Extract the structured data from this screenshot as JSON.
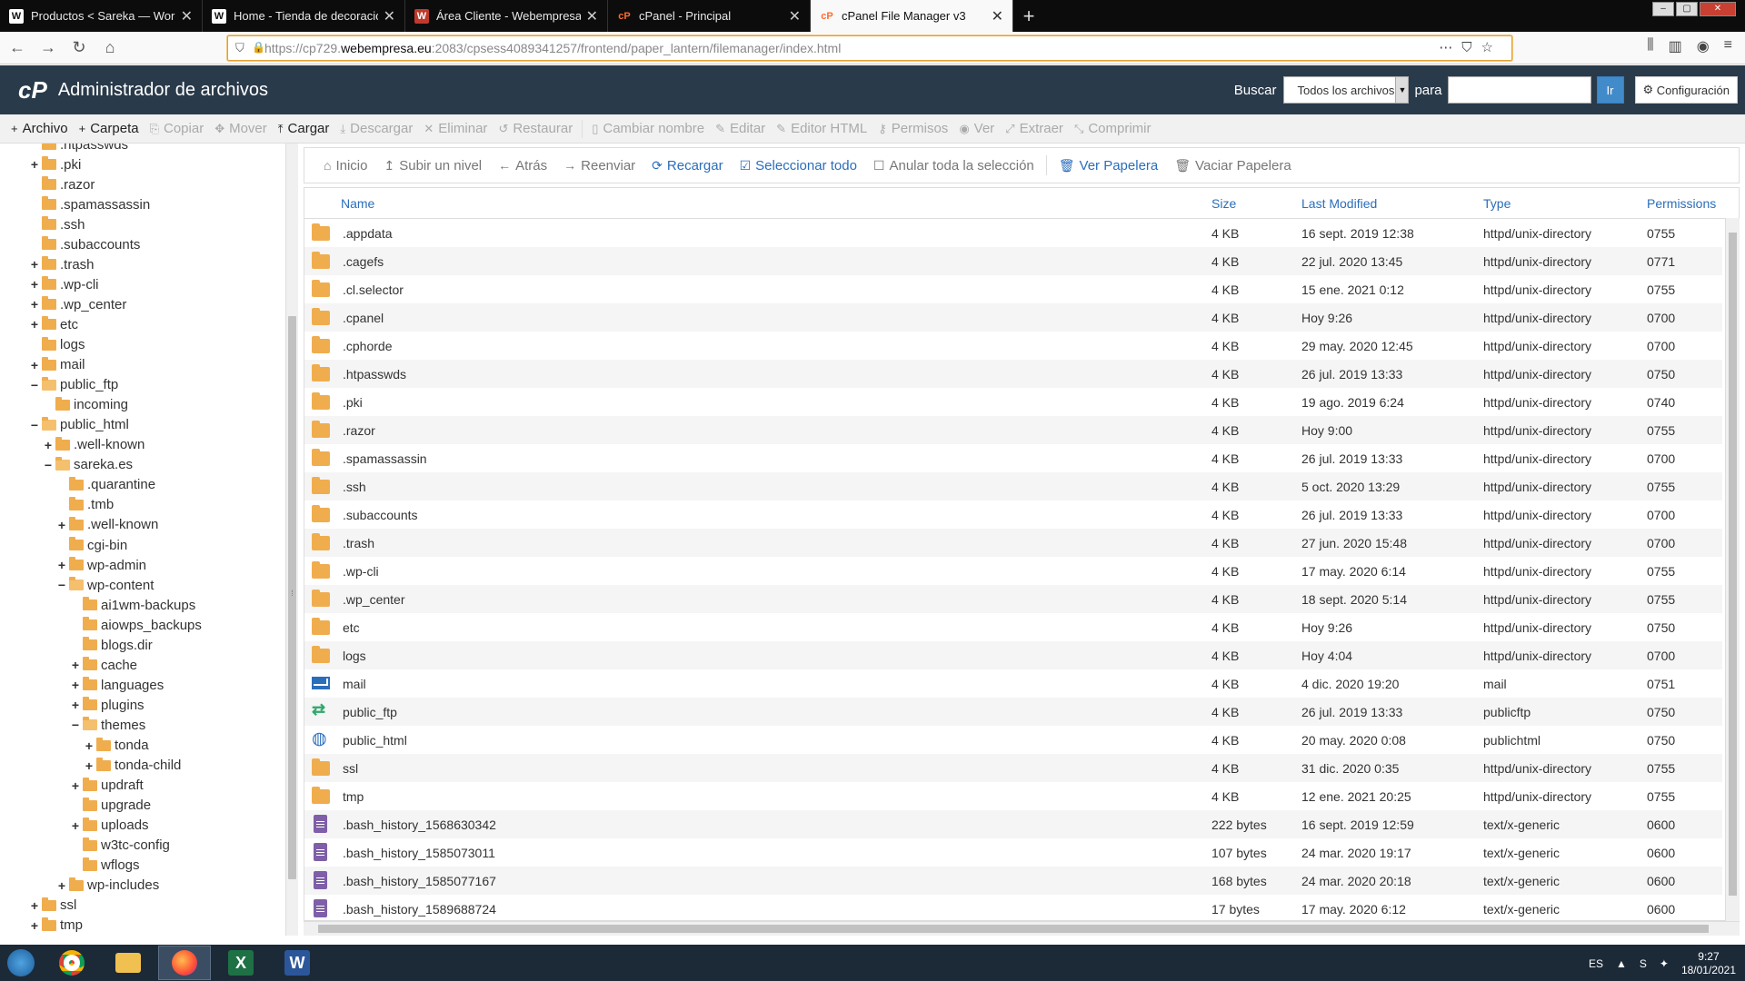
{
  "browser": {
    "tabs": [
      {
        "label": "Productos < Sareka — WordPre",
        "icon": "wordpress-icon"
      },
      {
        "label": "Home - Tienda de decoración",
        "icon": "wordpress-icon"
      },
      {
        "label": "Área Cliente - Webempresa Eur",
        "icon": "webempresa-icon"
      },
      {
        "label": "cPanel - Principal",
        "icon": "cpanel-icon"
      },
      {
        "label": "cPanel File Manager v3",
        "icon": "cpanel-icon"
      }
    ],
    "url_prefix": "https://cp729.",
    "url_domain": "webempresa.eu",
    "url_rest": ":2083/cpsess4089341257/frontend/paper_lantern/filemanager/index.html"
  },
  "header": {
    "logo": "cP",
    "title": "Administrador de archivos",
    "search_label": "Buscar",
    "search_scope": "Todos los archivos",
    "for_label": "para",
    "go_label": "Ir",
    "settings_label": "Configuración"
  },
  "toolbar": [
    {
      "label": "Archivo",
      "icon": "+",
      "enabled": true
    },
    {
      "label": "Carpeta",
      "icon": "+",
      "enabled": true
    },
    {
      "label": "Copiar",
      "icon": "⎘",
      "enabled": false
    },
    {
      "label": "Mover",
      "icon": "✥",
      "enabled": false
    },
    {
      "label": "Cargar",
      "icon": "⤒",
      "enabled": true
    },
    {
      "label": "Descargar",
      "icon": "⤓",
      "enabled": false
    },
    {
      "label": "Eliminar",
      "icon": "✕",
      "enabled": false
    },
    {
      "label": "Restaurar",
      "icon": "↺",
      "enabled": false
    },
    {
      "label": "Cambiar nombre",
      "icon": "▯",
      "enabled": false
    },
    {
      "label": "Editar",
      "icon": "✎",
      "enabled": false
    },
    {
      "label": "Editor HTML",
      "icon": "✎",
      "enabled": false
    },
    {
      "label": "Permisos",
      "icon": "⚷",
      "enabled": false
    },
    {
      "label": "Ver",
      "icon": "◉",
      "enabled": false
    },
    {
      "label": "Extraer",
      "icon": "⤢",
      "enabled": false
    },
    {
      "label": "Comprimir",
      "icon": "⤡",
      "enabled": false
    }
  ],
  "actions": [
    {
      "label": "Inicio",
      "icon": "⌂",
      "style": "grey"
    },
    {
      "label": "Subir un nivel",
      "icon": "↥",
      "style": "grey"
    },
    {
      "label": "Atrás",
      "icon": "←",
      "style": "grey"
    },
    {
      "label": "Reenviar",
      "icon": "→",
      "style": "grey"
    },
    {
      "label": "Recargar",
      "icon": "⟳",
      "style": "blue"
    },
    {
      "label": "Seleccionar todo",
      "icon": "☑",
      "style": "blue"
    },
    {
      "label": "Anular toda la selección",
      "icon": "☐",
      "style": "grey"
    },
    {
      "label": "Ver Papelera",
      "icon": "🗑",
      "style": "blue"
    },
    {
      "label": "Vaciar Papelera",
      "icon": "🗑",
      "style": "grey"
    }
  ],
  "tree": [
    {
      "label": ".htpasswds",
      "depth": 0,
      "toggle": "",
      "open": false
    },
    {
      "label": ".pki",
      "depth": 0,
      "toggle": "+",
      "open": false
    },
    {
      "label": ".razor",
      "depth": 0,
      "toggle": "",
      "open": false
    },
    {
      "label": ".spamassassin",
      "depth": 0,
      "toggle": "",
      "open": false
    },
    {
      "label": ".ssh",
      "depth": 0,
      "toggle": "",
      "open": false
    },
    {
      "label": ".subaccounts",
      "depth": 0,
      "toggle": "",
      "open": false
    },
    {
      "label": ".trash",
      "depth": 0,
      "toggle": "+",
      "open": false
    },
    {
      "label": ".wp-cli",
      "depth": 0,
      "toggle": "+",
      "open": false
    },
    {
      "label": ".wp_center",
      "depth": 0,
      "toggle": "+",
      "open": false
    },
    {
      "label": "etc",
      "depth": 0,
      "toggle": "+",
      "open": false
    },
    {
      "label": "logs",
      "depth": 0,
      "toggle": "",
      "open": false
    },
    {
      "label": "mail",
      "depth": 0,
      "toggle": "+",
      "open": false
    },
    {
      "label": "public_ftp",
      "depth": 0,
      "toggle": "−",
      "open": true
    },
    {
      "label": "incoming",
      "depth": 1,
      "toggle": "",
      "open": false
    },
    {
      "label": "public_html",
      "depth": 0,
      "toggle": "−",
      "open": true
    },
    {
      "label": ".well-known",
      "depth": 1,
      "toggle": "+",
      "open": false
    },
    {
      "label": "sareka.es",
      "depth": 1,
      "toggle": "−",
      "open": true
    },
    {
      "label": ".quarantine",
      "depth": 2,
      "toggle": "",
      "open": false
    },
    {
      "label": ".tmb",
      "depth": 2,
      "toggle": "",
      "open": false
    },
    {
      "label": ".well-known",
      "depth": 2,
      "toggle": "+",
      "open": false
    },
    {
      "label": "cgi-bin",
      "depth": 2,
      "toggle": "",
      "open": false
    },
    {
      "label": "wp-admin",
      "depth": 2,
      "toggle": "+",
      "open": false
    },
    {
      "label": "wp-content",
      "depth": 2,
      "toggle": "−",
      "open": true
    },
    {
      "label": "ai1wm-backups",
      "depth": 3,
      "toggle": "",
      "open": false
    },
    {
      "label": "aiowps_backups",
      "depth": 3,
      "toggle": "",
      "open": false
    },
    {
      "label": "blogs.dir",
      "depth": 3,
      "toggle": "",
      "open": false
    },
    {
      "label": "cache",
      "depth": 3,
      "toggle": "+",
      "open": false
    },
    {
      "label": "languages",
      "depth": 3,
      "toggle": "+",
      "open": false
    },
    {
      "label": "plugins",
      "depth": 3,
      "toggle": "+",
      "open": false
    },
    {
      "label": "themes",
      "depth": 3,
      "toggle": "−",
      "open": true
    },
    {
      "label": "tonda",
      "depth": 4,
      "toggle": "+",
      "open": false
    },
    {
      "label": "tonda-child",
      "depth": 4,
      "toggle": "+",
      "open": false
    },
    {
      "label": "updraft",
      "depth": 3,
      "toggle": "+",
      "open": false
    },
    {
      "label": "upgrade",
      "depth": 3,
      "toggle": "",
      "open": false
    },
    {
      "label": "uploads",
      "depth": 3,
      "toggle": "+",
      "open": false
    },
    {
      "label": "w3tc-config",
      "depth": 3,
      "toggle": "",
      "open": false
    },
    {
      "label": "wflogs",
      "depth": 3,
      "toggle": "",
      "open": false
    },
    {
      "label": "wp-includes",
      "depth": 2,
      "toggle": "+",
      "open": false
    },
    {
      "label": "ssl",
      "depth": 0,
      "toggle": "+",
      "open": false
    },
    {
      "label": "tmp",
      "depth": 0,
      "toggle": "+",
      "open": false
    }
  ],
  "columns": {
    "name": "Name",
    "size": "Size",
    "modified": "Last Modified",
    "type": "Type",
    "perms": "Permissions"
  },
  "files": [
    {
      "icon": "folder",
      "name": ".appdata",
      "size": "4 KB",
      "modified": "16 sept. 2019 12:38",
      "type": "httpd/unix-directory",
      "perms": "0755"
    },
    {
      "icon": "folder",
      "name": ".cagefs",
      "size": "4 KB",
      "modified": "22 jul. 2020 13:45",
      "type": "httpd/unix-directory",
      "perms": "0771"
    },
    {
      "icon": "folder",
      "name": ".cl.selector",
      "size": "4 KB",
      "modified": "15 ene. 2021 0:12",
      "type": "httpd/unix-directory",
      "perms": "0755"
    },
    {
      "icon": "folder",
      "name": ".cpanel",
      "size": "4 KB",
      "modified": "Hoy 9:26",
      "type": "httpd/unix-directory",
      "perms": "0700"
    },
    {
      "icon": "folder",
      "name": ".cphorde",
      "size": "4 KB",
      "modified": "29 may. 2020 12:45",
      "type": "httpd/unix-directory",
      "perms": "0700"
    },
    {
      "icon": "folder",
      "name": ".htpasswds",
      "size": "4 KB",
      "modified": "26 jul. 2019 13:33",
      "type": "httpd/unix-directory",
      "perms": "0750"
    },
    {
      "icon": "folder",
      "name": ".pki",
      "size": "4 KB",
      "modified": "19 ago. 2019 6:24",
      "type": "httpd/unix-directory",
      "perms": "0740"
    },
    {
      "icon": "folder",
      "name": ".razor",
      "size": "4 KB",
      "modified": "Hoy 9:00",
      "type": "httpd/unix-directory",
      "perms": "0755"
    },
    {
      "icon": "folder",
      "name": ".spamassassin",
      "size": "4 KB",
      "modified": "26 jul. 2019 13:33",
      "type": "httpd/unix-directory",
      "perms": "0700"
    },
    {
      "icon": "folder",
      "name": ".ssh",
      "size": "4 KB",
      "modified": "5 oct. 2020 13:29",
      "type": "httpd/unix-directory",
      "perms": "0755"
    },
    {
      "icon": "folder",
      "name": ".subaccounts",
      "size": "4 KB",
      "modified": "26 jul. 2019 13:33",
      "type": "httpd/unix-directory",
      "perms": "0700"
    },
    {
      "icon": "folder",
      "name": ".trash",
      "size": "4 KB",
      "modified": "27 jun. 2020 15:48",
      "type": "httpd/unix-directory",
      "perms": "0700"
    },
    {
      "icon": "folder",
      "name": ".wp-cli",
      "size": "4 KB",
      "modified": "17 may. 2020 6:14",
      "type": "httpd/unix-directory",
      "perms": "0755"
    },
    {
      "icon": "folder",
      "name": ".wp_center",
      "size": "4 KB",
      "modified": "18 sept. 2020 5:14",
      "type": "httpd/unix-directory",
      "perms": "0755"
    },
    {
      "icon": "folder",
      "name": "etc",
      "size": "4 KB",
      "modified": "Hoy 9:26",
      "type": "httpd/unix-directory",
      "perms": "0750"
    },
    {
      "icon": "folder",
      "name": "logs",
      "size": "4 KB",
      "modified": "Hoy 4:04",
      "type": "httpd/unix-directory",
      "perms": "0700"
    },
    {
      "icon": "mail",
      "name": "mail",
      "size": "4 KB",
      "modified": "4 dic. 2020 19:20",
      "type": "mail",
      "perms": "0751"
    },
    {
      "icon": "ftp",
      "name": "public_ftp",
      "size": "4 KB",
      "modified": "26 jul. 2019 13:33",
      "type": "publicftp",
      "perms": "0750"
    },
    {
      "icon": "web",
      "name": "public_html",
      "size": "4 KB",
      "modified": "20 may. 2020 0:08",
      "type": "publichtml",
      "perms": "0750"
    },
    {
      "icon": "folder",
      "name": "ssl",
      "size": "4 KB",
      "modified": "31 dic. 2020 0:35",
      "type": "httpd/unix-directory",
      "perms": "0755"
    },
    {
      "icon": "folder",
      "name": "tmp",
      "size": "4 KB",
      "modified": "12 ene. 2021 20:25",
      "type": "httpd/unix-directory",
      "perms": "0755"
    },
    {
      "icon": "file",
      "name": ".bash_history_1568630342",
      "size": "222 bytes",
      "modified": "16 sept. 2019 12:59",
      "type": "text/x-generic",
      "perms": "0600"
    },
    {
      "icon": "file",
      "name": ".bash_history_1585073011",
      "size": "107 bytes",
      "modified": "24 mar. 2020 19:17",
      "type": "text/x-generic",
      "perms": "0600"
    },
    {
      "icon": "file",
      "name": ".bash_history_1585077167",
      "size": "168 bytes",
      "modified": "24 mar. 2020 20:18",
      "type": "text/x-generic",
      "perms": "0600"
    },
    {
      "icon": "file",
      "name": ".bash_history_1589688724",
      "size": "17 bytes",
      "modified": "17 may. 2020 6:12",
      "type": "text/x-generic",
      "perms": "0600"
    }
  ],
  "taskbar": {
    "lang": "ES",
    "time": "9:27",
    "date": "18/01/2021"
  }
}
